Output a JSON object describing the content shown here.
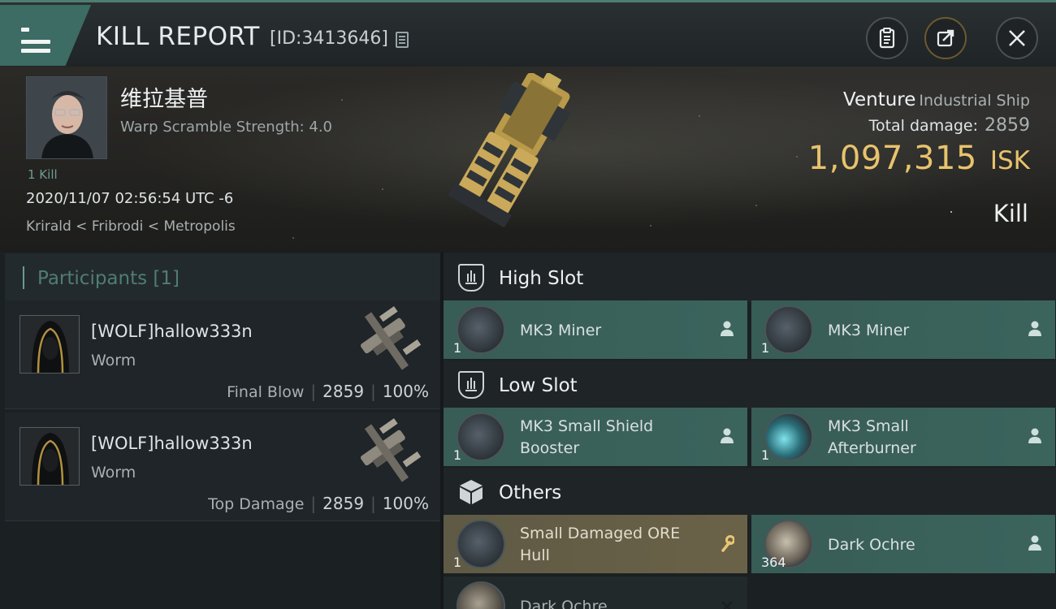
{
  "header": {
    "title": "KILL REPORT",
    "report_id": "[ID:3413646]"
  },
  "victim": {
    "name": "维拉基普",
    "warp_scramble": "Warp Scramble Strength: 4.0",
    "kill_count": "1 Kill",
    "date": "2020/11/07 02:56:54 UTC -6",
    "location": "Krirald < Fribrodi < Metropolis"
  },
  "ship": {
    "name": "Venture",
    "class": "Industrial Ship",
    "total_damage_label": "Total damage:",
    "total_damage": "2859",
    "isk_value": "1,097,315",
    "isk_unit": "ISK",
    "result": "Kill"
  },
  "participants": {
    "title": "Participants [1]",
    "rows": [
      {
        "name": "[WOLF]hallow333n",
        "ship": "Worm",
        "label": "Final Blow",
        "damage": "2859",
        "percent": "100%"
      },
      {
        "name": "[WOLF]hallow333n",
        "ship": "Worm",
        "label": "Top Damage",
        "damage": "2859",
        "percent": "100%"
      }
    ]
  },
  "slots": {
    "high": {
      "title": "High Slot",
      "items": [
        {
          "qty": "1",
          "name": "MK3 Miner"
        },
        {
          "qty": "1",
          "name": "MK3 Miner"
        }
      ]
    },
    "low": {
      "title": "Low Slot",
      "items": [
        {
          "qty": "1",
          "name_line1": "MK3 Small Shield",
          "name_line2": "Booster"
        },
        {
          "qty": "1",
          "name_line1": "MK3 Small",
          "name_line2": "Afterburner"
        }
      ]
    },
    "others": {
      "title": "Others",
      "items": [
        {
          "qty": "1",
          "name_line1": "Small Damaged ORE",
          "name_line2": "Hull"
        },
        {
          "qty": "364",
          "name": "Dark Ochre"
        },
        {
          "qty": "",
          "name": "Dark Ochre"
        }
      ]
    }
  },
  "colors": {
    "accent_teal": "#3b645d",
    "isk_gold": "#e8c36d",
    "salvage_tan": "#6a6248"
  }
}
